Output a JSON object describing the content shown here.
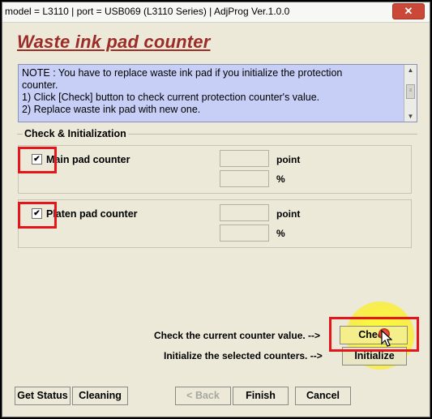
{
  "window": {
    "title": "model = L3110 | port = USB069 (L3110 Series) | AdjProg Ver.1.0.0",
    "close_glyph": "✕"
  },
  "page_title": "Waste ink pad counter",
  "note": {
    "line1": "NOTE : You have to replace waste ink pad if you initialize the protection",
    "line2": "counter.",
    "line3": "1) Click [Check] button to check current protection counter's value.",
    "line4": "2) Replace waste ink pad with new one."
  },
  "group": {
    "label": "Check & Initialization"
  },
  "counters": {
    "main": {
      "label": "Main pad counter",
      "checked": true,
      "check_glyph": "✔",
      "point_value": "",
      "percent_value": "",
      "point_unit": "point",
      "percent_unit": "%"
    },
    "platen": {
      "label": "Platen pad counter",
      "checked": true,
      "check_glyph": "✔",
      "point_value": "",
      "percent_value": "",
      "point_unit": "point",
      "percent_unit": "%"
    }
  },
  "actions": {
    "check_hint": "Check the current counter value. -->",
    "check_label": "Check",
    "initialize_hint": "Initialize the selected counters. -->",
    "initialize_label": "Initialize"
  },
  "footer": {
    "get_status": "Get Status",
    "cleaning": "Cleaning",
    "back": "< Back",
    "finish": "Finish",
    "cancel": "Cancel"
  },
  "colors": {
    "title_red": "#9b2c27",
    "note_bg": "#c7cff7",
    "dialog_bg": "#ece9d8",
    "annotation_red": "#e4151b",
    "highlight_yellow": "#ffff28"
  },
  "icons": {
    "scroll_up": "▲",
    "scroll_down": "▼",
    "scroll_grip": "≡"
  }
}
